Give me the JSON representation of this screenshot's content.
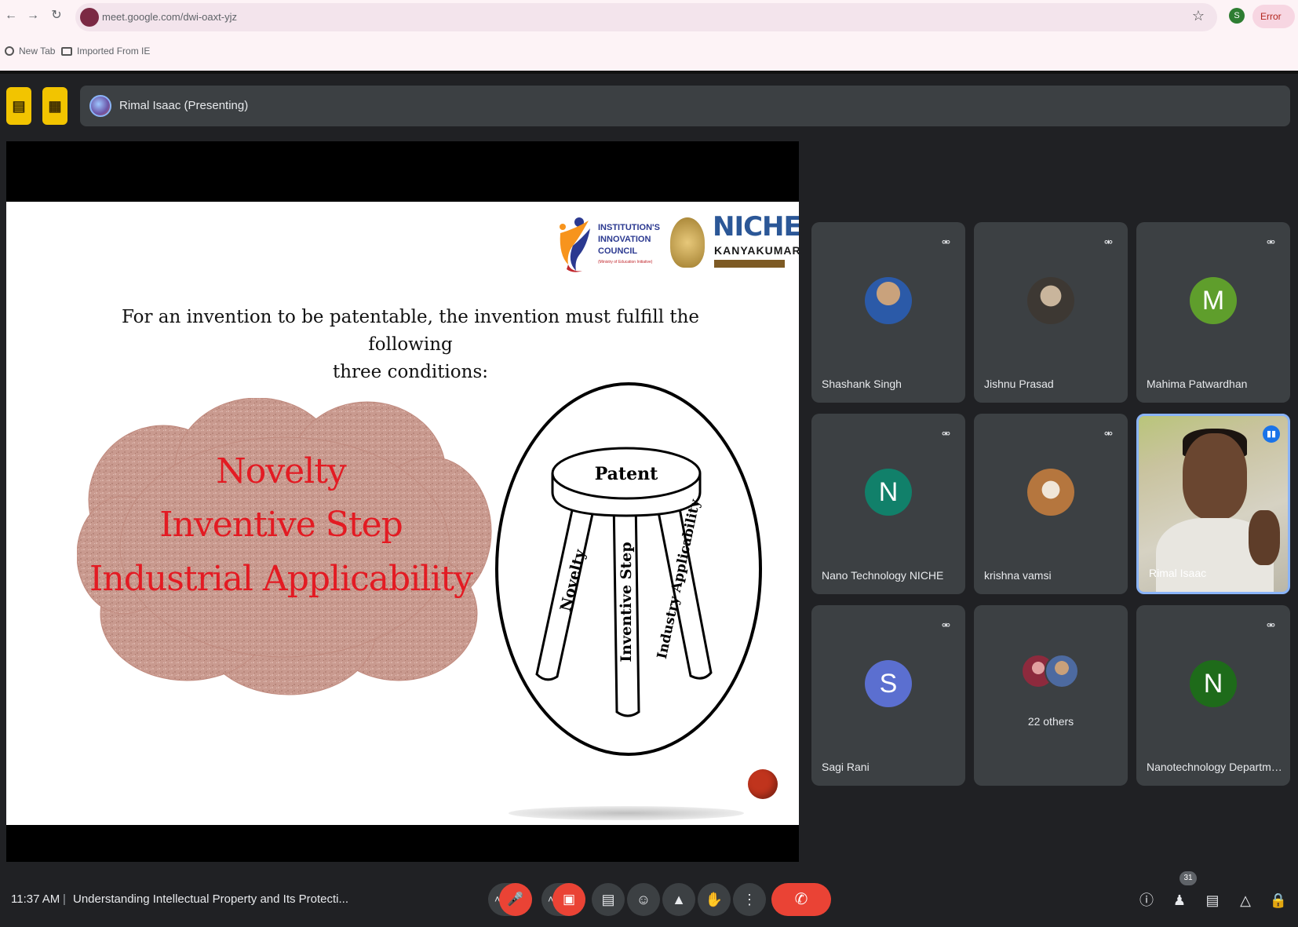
{
  "browser": {
    "url": "meet.google.com/dwi-oaxt-yjz",
    "profile_initial": "S",
    "error_label": "Error",
    "bookmarks": [
      {
        "label": "New Tab"
      },
      {
        "label": "Imported From IE"
      }
    ]
  },
  "meet_header": {
    "presenter_label": "Rimal Isaac (Presenting)"
  },
  "slide": {
    "logo_iic_lines": [
      "INSTITUTION'S",
      "INNOVATION",
      "COUNCIL"
    ],
    "logo_iic_sub": "(Ministry of Education Initiative)",
    "logo_niche_title": "NICHE",
    "logo_niche_sub": "KANYAKUMARI",
    "heading_line1": "For an invention to be patentable, the invention must fulfill the following",
    "heading_line2": "three conditions:",
    "cloud_items": [
      "Novelty",
      "Inventive Step",
      "Industrial Applicability"
    ],
    "stool_seat": "Patent",
    "stool_legs": [
      "Novelty",
      "Inventive Step",
      "Industry Applicability"
    ]
  },
  "participants": [
    {
      "name": "Shashank Singh",
      "avatar_type": "photo",
      "colors": [
        "#2b5aa8",
        "#c9a27c"
      ]
    },
    {
      "name": "Jishnu Prasad",
      "avatar_type": "photo",
      "colors": [
        "#3d3833",
        "#c9b59c"
      ]
    },
    {
      "name": "Mahima Patwardhan",
      "avatar_type": "letter",
      "letter": "M",
      "color": "#5f9e2c"
    },
    {
      "name": "Nano Technology NICHE",
      "avatar_type": "letter",
      "letter": "N",
      "color": "#11806a"
    },
    {
      "name": "krishna vamsi",
      "avatar_type": "photo",
      "colors": [
        "#b5763e",
        "#f0e6d8"
      ]
    },
    {
      "name": "Rimal Isaac",
      "avatar_type": "video",
      "speaking": true
    },
    {
      "name": "Sagi Rani",
      "avatar_type": "letter",
      "letter": "S",
      "color": "#5b6fd0"
    },
    {
      "name": "22 others",
      "avatar_type": "group"
    },
    {
      "name": "Nanotechnology Departme...",
      "avatar_type": "letter",
      "letter": "N",
      "color": "#1e6b1a"
    }
  ],
  "bottom_bar": {
    "time": "11:37 AM",
    "separator": "|",
    "meeting_title": "Understanding Intellectual Property and Its Protecti...",
    "participant_count": "31",
    "controls": [
      {
        "name": "mic-off-icon"
      },
      {
        "name": "camera-off-icon"
      },
      {
        "name": "captions-icon"
      },
      {
        "name": "emoji-icon"
      },
      {
        "name": "present-icon"
      },
      {
        "name": "raise-hand-icon"
      },
      {
        "name": "more-options-icon"
      },
      {
        "name": "end-call-icon"
      }
    ]
  },
  "colors": {
    "meet_bg": "#202124",
    "tile_bg": "#3c4043",
    "danger_red": "#ea4335",
    "accent_yellow": "#f2c400",
    "accent_blue": "#8ab4f8",
    "slide_red_text": "#e31b23"
  }
}
